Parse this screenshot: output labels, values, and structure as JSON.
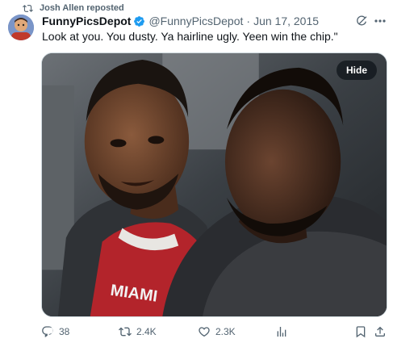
{
  "repost": {
    "label": "Josh Allen reposted",
    "icon": "repost-icon"
  },
  "author": {
    "name": "FunnyPicsDepot",
    "handle": "@FunnyPicsDepot",
    "separator": "·",
    "date": "Jun 17, 2015",
    "verified": true
  },
  "post": {
    "text": "Look at you. You dusty. Ya hairline ugly. Yeen win the chip.\""
  },
  "media": {
    "hide_label": "Hide",
    "description_icon": "photo"
  },
  "actions": {
    "replies": "38",
    "reposts": "2.4K",
    "likes": "2.3K"
  },
  "colors": {
    "accent": "#1d9bf0",
    "secondary_text": "#536471",
    "jersey_red": "#b3242b"
  }
}
